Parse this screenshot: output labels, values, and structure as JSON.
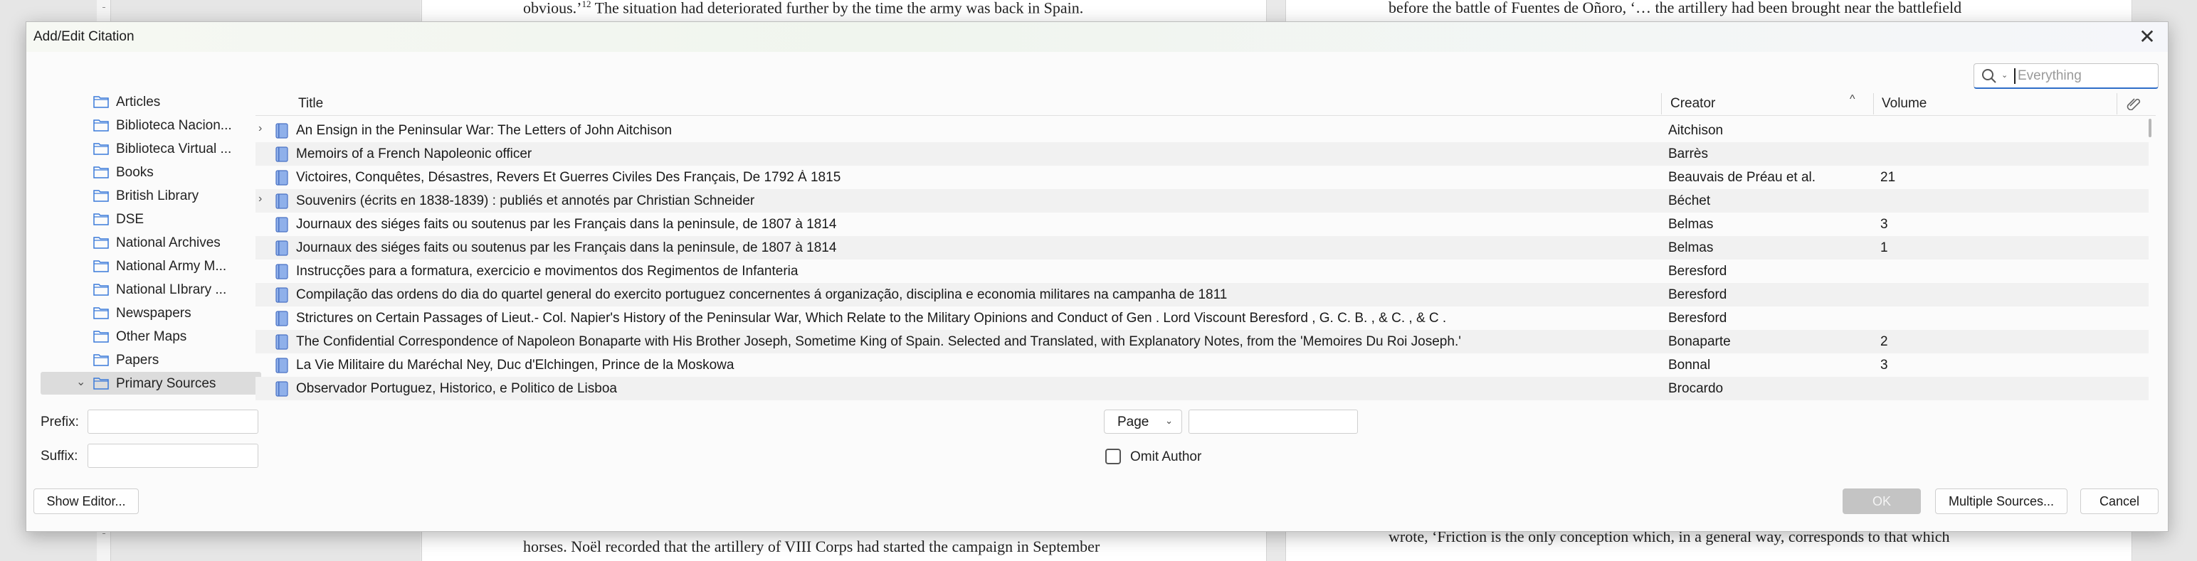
{
  "background_doc": {
    "p1_top": "obvious.’",
    "p1_top_note": "12",
    "p1_top_rest": " The situation had deteriorated further by the time the army was back in Spain.",
    "p2_top": "before the battle of Fuentes de Oñoro, ‘… the artillery had been brought near the battlefield",
    "p1_bottom": "horses. Noël recorded that the artillery of VIII Corps had started the campaign in September",
    "p2_bottom": "wrote, ‘Friction is the only conception which, in a general way, corresponds to that which"
  },
  "dialog": {
    "title": "Add/Edit Citation",
    "close_label": "✕"
  },
  "search": {
    "placeholder": "Everything",
    "value": ""
  },
  "collections": [
    {
      "label": "Articles"
    },
    {
      "label": "Biblioteca Nacion..."
    },
    {
      "label": "Biblioteca Virtual ..."
    },
    {
      "label": "Books"
    },
    {
      "label": "British Library"
    },
    {
      "label": "DSE"
    },
    {
      "label": "National Archives"
    },
    {
      "label": "National Army M..."
    },
    {
      "label": "National LIbrary ..."
    },
    {
      "label": "Newspapers"
    },
    {
      "label": "Other Maps"
    },
    {
      "label": "Papers"
    },
    {
      "label": "Primary Sources",
      "selected": true,
      "twisty": "⌄"
    }
  ],
  "table": {
    "columns": {
      "title": "Title",
      "creator": "Creator",
      "volume": "Volume",
      "sort_indicator": "^"
    },
    "rows": [
      {
        "expand": "›",
        "title": "An Ensign in the Peninsular War: The Letters of John Aitchison",
        "creator": "Aitchison",
        "volume": ""
      },
      {
        "expand": "",
        "title": "Memoirs of a French Napoleonic officer",
        "creator": "Barrès",
        "volume": ""
      },
      {
        "expand": "",
        "title": "Victoires, Conquêtes, Désastres, Revers Et Guerres Civiles Des Français, De 1792 À 1815",
        "creator": "Beauvais de Préau et al.",
        "volume": "21"
      },
      {
        "expand": "›",
        "title": "Souvenirs (écrits en 1838-1839) : publiés et annotés par Christian Schneider",
        "creator": "Béchet",
        "volume": ""
      },
      {
        "expand": "",
        "title": "Journaux des siéges faits ou soutenus par les Français dans la peninsule, de 1807 à 1814",
        "creator": "Belmas",
        "volume": "3"
      },
      {
        "expand": "",
        "title": "Journaux des siéges faits ou soutenus par les Français dans la peninsule, de 1807 à 1814",
        "creator": "Belmas",
        "volume": "1"
      },
      {
        "expand": "",
        "title": "Instrucções para a formatura, exercicio e movimentos dos Regimentos de Infanteria",
        "creator": "Beresford",
        "volume": ""
      },
      {
        "expand": "",
        "title": "Compilação das ordens do dia do quartel general do exercito portuguez concernentes á organização, disciplina e economia militares na campanha de 1811",
        "creator": "Beresford",
        "volume": ""
      },
      {
        "expand": "",
        "title": "Strictures on Certain Passages of Lieut.- Col. Napier's History of the Peninsular War, Which Relate to the Military Opinions and Conduct of Gen . Lord Viscount Beresford , G. C. B. , & C. , & C .",
        "creator": "Beresford",
        "volume": ""
      },
      {
        "expand": "",
        "title": "The Confidential Correspondence of Napoleon Bonaparte with His Brother Joseph, Sometime King of Spain. Selected and Translated, with Explanatory Notes, from the 'Memoires Du Roi Joseph.'",
        "creator": "Bonaparte",
        "volume": "2"
      },
      {
        "expand": "",
        "title": "La Vie Militaire du Maréchal Ney, Duc d'Elchingen, Prince de la Moskowa",
        "creator": "Bonnal",
        "volume": "3"
      },
      {
        "expand": "",
        "title": "Observador Portuguez, Historico, e Politico de Lisboa",
        "creator": "Brocardo",
        "volume": ""
      }
    ]
  },
  "form": {
    "prefix_label": "Prefix:",
    "suffix_label": "Suffix:",
    "prefix_value": "",
    "suffix_value": "",
    "locator_type": "Page",
    "locator_value": "",
    "omit_author_label": "Omit Author",
    "omit_author_checked": false
  },
  "buttons": {
    "show_editor": "Show Editor...",
    "ok": "OK",
    "multiple_sources": "Multiple Sources...",
    "cancel": "Cancel"
  },
  "colors": {
    "accent": "#2f6ec8",
    "book_icon": "#6b8fd6",
    "folder_icon": "#3b7ad9",
    "ok_disabled": "#c4c4c4"
  }
}
